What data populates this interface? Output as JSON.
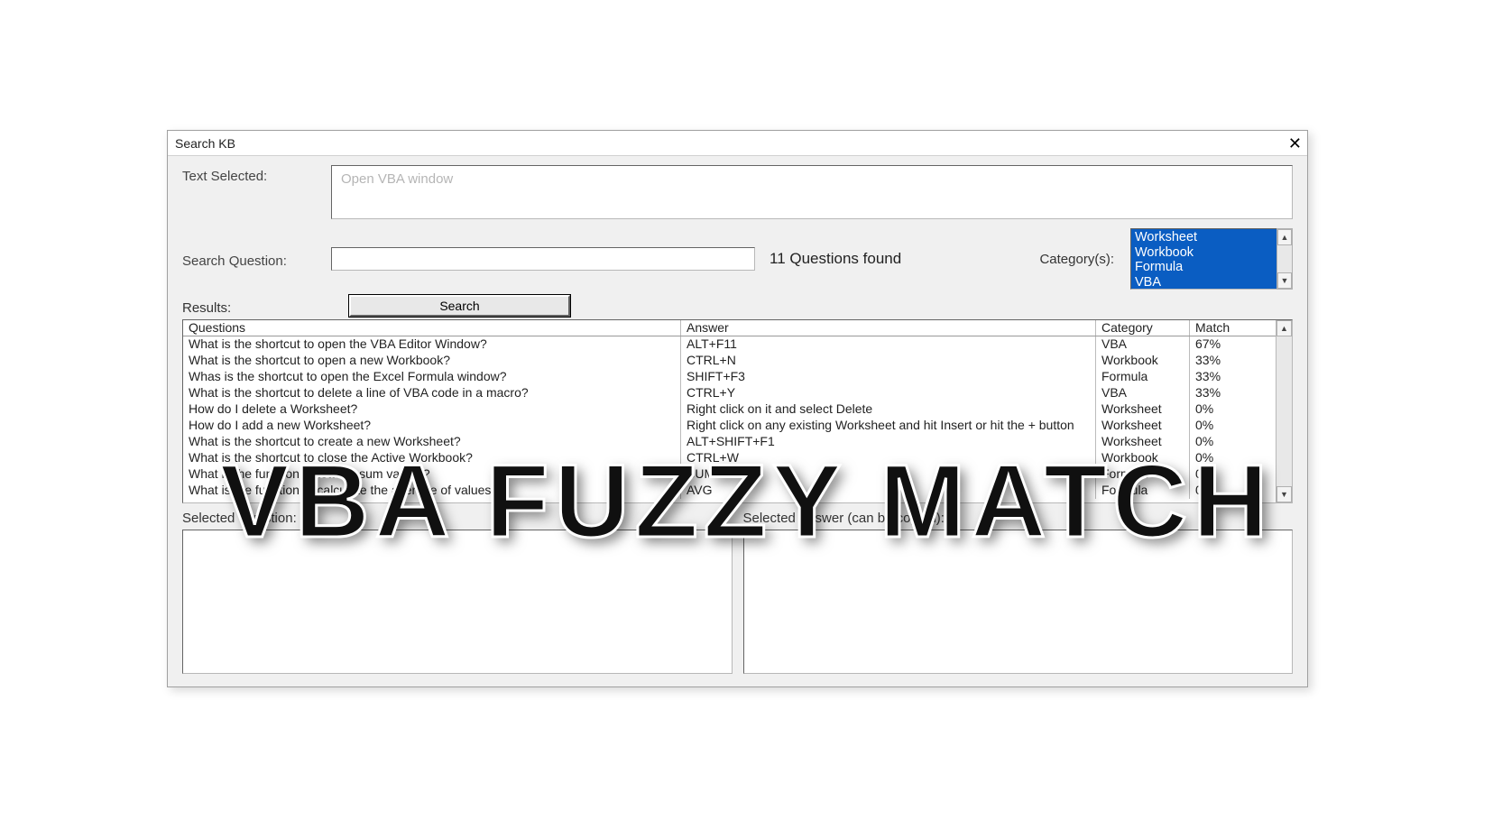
{
  "dialog": {
    "title": "Search KB",
    "text_selected_label": "Text Selected:",
    "text_selected_value": "Open VBA window",
    "search_question_label": "Search Question:",
    "search_input_value": "",
    "questions_found_text": "11 Questions found",
    "category_label": "Category(s):",
    "categories": [
      "Worksheet",
      "Workbook",
      "Formula",
      "VBA"
    ],
    "search_button_label": "Search",
    "results_label": "Results:",
    "columns": {
      "q": "Questions",
      "a": "Answer",
      "c": "Category",
      "m": "Match"
    },
    "rows": [
      {
        "q": "What is the shortcut to open the VBA Editor Window?",
        "a": "ALT+F11",
        "c": "VBA",
        "m": "67%"
      },
      {
        "q": "What is the shortcut to open a new Workbook?",
        "a": "CTRL+N",
        "c": "Workbook",
        "m": "33%"
      },
      {
        "q": "Whas is the shortcut to open the Excel Formula window?",
        "a": "SHIFT+F3",
        "c": "Formula",
        "m": "33%"
      },
      {
        "q": "What is the shortcut to delete a line of VBA code in a macro?",
        "a": "CTRL+Y",
        "c": "VBA",
        "m": "33%"
      },
      {
        "q": "How do I delete a Worksheet?",
        "a": "Right click on it and select Delete",
        "c": "Worksheet",
        "m": "0%"
      },
      {
        "q": "How do I add a new Worksheet?",
        "a": "Right click on any existing Worksheet and hit Insert or hit the + button",
        "c": "Worksheet",
        "m": "0%"
      },
      {
        "q": "What is the shortcut to create a new Worksheet?",
        "a": "ALT+SHIFT+F1",
        "c": "Worksheet",
        "m": "0%"
      },
      {
        "q": "What is the shortcut to close the Active Workbook?",
        "a": "CTRL+W",
        "c": "Workbook",
        "m": "0%"
      },
      {
        "q": "What is the function to total or sum values?",
        "a": "SUM",
        "c": "Formula",
        "m": "0%"
      },
      {
        "q": "What is the function to calculate the average of values?",
        "a": "AVG",
        "c": "Formula",
        "m": "0%"
      }
    ],
    "selected_question_label": "Selected Question:",
    "selected_answer_label": "Selected Answer (can be copied):"
  },
  "overlay_text": "VBA FUZZY MATCH"
}
